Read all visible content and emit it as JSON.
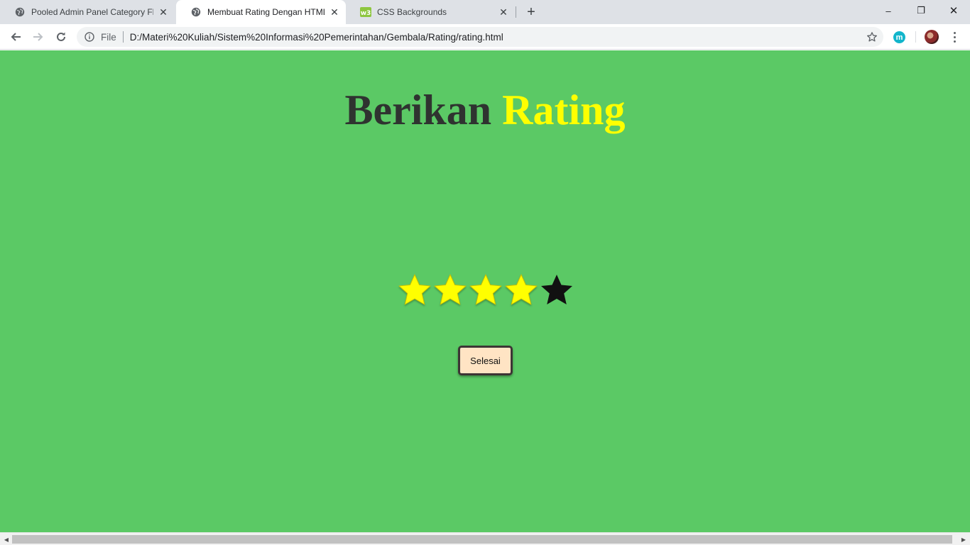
{
  "browser": {
    "tabs": [
      {
        "title": "Pooled Admin Panel Category Fla",
        "active": false,
        "icon": "globe-icon"
      },
      {
        "title": "Membuat Rating Dengan HTML C",
        "active": true,
        "icon": "globe-icon"
      },
      {
        "title": "CSS Backgrounds",
        "active": false,
        "icon": "w3schools-icon"
      }
    ],
    "new_tab": "+",
    "window_controls": {
      "minimize": "–",
      "restore": "❐",
      "close": "✕"
    },
    "address_bar": {
      "scheme_label": "File",
      "url": "D:/Materi%20Kuliah/Sistem%20Informasi%20Pemerintahan/Gembala/Rating/rating.html"
    },
    "extension_label": "m"
  },
  "page": {
    "background_color": "#5bc965",
    "heading": {
      "word1": "Berikan",
      "word2": "Rating",
      "word2_color": "#ffff00"
    },
    "rating": {
      "value": 4,
      "max": 5,
      "filled_color": "#ffff00",
      "empty_color": "#111111"
    },
    "done_button": "Selesai"
  }
}
